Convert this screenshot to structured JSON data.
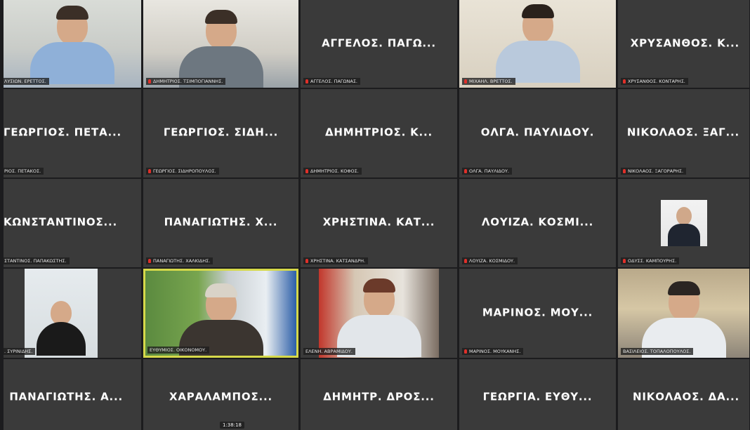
{
  "meeting": {
    "timer": "1:38:18"
  },
  "tiles": [
    {
      "display": "",
      "label": "ΛΥΣΙΩΝ. ΕΡΕΤΤΟΣ."
    },
    {
      "display": "",
      "label": "ΔΗΜΗΤΡΙΟΣ. ΤΣΙΜΠΟΓΙΑΝΝΗΣ."
    },
    {
      "display": "ΑΓΓΕΛΟΣ. ΠΑΓΩ...",
      "label": "ΑΓΓΕΛΟΣ. ΠΑΓΩΝΑΣ."
    },
    {
      "display": "",
      "label": "ΜΙΧΑΗΛ. ΒΡΕΤΤΟΣ."
    },
    {
      "display": "ΧΡΥΣΑΝΘΟΣ. Κ...",
      "label": "ΧΡΥΣΑΝΘΟΣ. ΚΟΝΤΑΡΗΣ."
    },
    {
      "display": "ΓΕΩΡΓΙΟΣ. ΠΕΤΑ...",
      "label": "ΡΙΟΣ. ΠΕΤΑΚΟΣ."
    },
    {
      "display": "ΓΕΩΡΓΙΟΣ. ΣΙΔΗ...",
      "label": "ΓΕΩΡΓΙΟΣ. ΣΙΔΗΡΟΠΟΥΛΟΣ."
    },
    {
      "display": "ΔΗΜΗΤΡΙΟΣ. Κ...",
      "label": "ΔΗΜΗΤΡΙΟΣ. ΚΟΦΟΣ."
    },
    {
      "display": "ΟΛΓΑ. ΠΑΥΛΙΔΟΥ.",
      "label": "ΟΛΓΑ. ΠΑΥΛΙΔΟΥ."
    },
    {
      "display": "ΝΙΚΟΛΑΟΣ. ΞΑΓ...",
      "label": "ΝΙΚΟΛΑΟΣ. ΞΑΓΟΡΑΡΗΣ."
    },
    {
      "display": "ΚΩΝΣΤΑΝΤΙΝΟΣ...",
      "label": "ΣΤΑΝΤΙΝΟΣ. ΠΑΠΑΚΩΣΤΗΣ."
    },
    {
      "display": "ΠΑΝΑΓΙΩΤΗΣ. Χ...",
      "label": "ΠΑΝΑΓΙΩΤΗΣ. ΧΑΛΚΙΔΗΣ."
    },
    {
      "display": "ΧΡΗΣΤΙΝΑ. ΚΑΤ...",
      "label": "ΧΡΗΣΤΙΝΑ. ΚΑΤΣΑΝΔΡΗ."
    },
    {
      "display": "ΛΟΥΙΖΑ. ΚΟΣΜΙ...",
      "label": "ΛΟΥΙΖΑ. ΚΟΣΜΙΔΟΥ."
    },
    {
      "display": "",
      "label": "ΟΔΥΣΣ. ΚΑΜΠΟΥΡΗΣ."
    },
    {
      "display": "",
      "label": ". ΣΥΡΙΝΙΔΗΣ."
    },
    {
      "display": "",
      "label": "ΕΥΘΥΜΙΟΣ. ΟΙΚΟΝΟΜΟΥ."
    },
    {
      "display": "",
      "label": "ΕΛΕΝΗ. ΑΒΡΑΜΙΔΟΥ."
    },
    {
      "display": "ΜΑΡΙΝΟΣ. ΜΟΥ...",
      "label": "ΜΑΡΙΝΟΣ. ΜΟΥΚΑΝΗΣ."
    },
    {
      "display": "",
      "label": "ΒΑΣΙΛΕΙΟΣ. ΤΟΠΑΛΟΠΟΥΛΟΣ."
    },
    {
      "display": "ΠΑΝΑΓΙΩΤΗΣ. Α...",
      "label": ""
    },
    {
      "display": "ΧΑΡΑΛΑΜΠΟΣ...",
      "label": ""
    },
    {
      "display": "ΔΗΜΗΤΡ. ΔΡΟΣ...",
      "label": ""
    },
    {
      "display": "ΓΕΩΡΓΙΑ. ΕΥΘΥ...",
      "label": ""
    },
    {
      "display": "ΝΙΚΟΛΑΟΣ. ΔΑ...",
      "label": ""
    }
  ]
}
